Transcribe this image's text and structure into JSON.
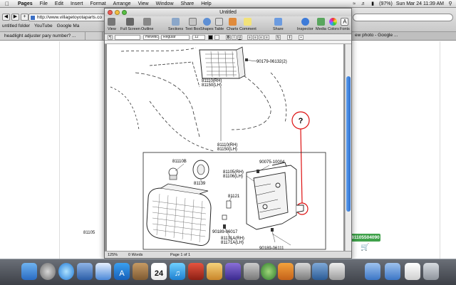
{
  "menubar": {
    "apple": "",
    "items": [
      "Pages",
      "File",
      "Edit",
      "Insert",
      "Format",
      "Arrange",
      "View",
      "Window",
      "Share",
      "Help"
    ],
    "battery": "(97%)",
    "clock": "Sun Mar 24  11:39 AM"
  },
  "browser": {
    "url": "http://www.villagetoyotaparts.co",
    "bookmarks": [
      "untitled folder",
      "YouTube",
      "Google Ma"
    ],
    "tabs": [
      "headlight adjuster pary number? ...",
      "",
      ""
    ],
    "tab_right": "ew photo - Google ...",
    "part_label_left": "81105",
    "part_badge": "81105504090"
  },
  "pages_window": {
    "title": "Untitled",
    "toolbar": [
      "View",
      "Full Screen",
      "Outline",
      "Sections",
      "Text Box",
      "Shapes",
      "Table",
      "Charts",
      "Comment",
      "Share",
      "Inspector",
      "Media",
      "Colors",
      "Fonts"
    ],
    "font_name": "Helvetica",
    "font_style": "Regular",
    "font_size": "12",
    "status": {
      "zoom": "125%",
      "words": "0 Words",
      "page": "Page 1 of 1"
    }
  },
  "diagram": {
    "question": "?",
    "labels": {
      "top_code": "90179-06132(2)",
      "top_rh": "81110(RH)",
      "top_lh": "81150(LH)",
      "mid_rh": "81110(RH)",
      "mid_lh": "81150(LH)",
      "bulb": "81110B",
      "bracket_top": "90075-10004",
      "unit_rh": "81105(RH)",
      "unit_lh": "81106(LH)",
      "socket": "81139",
      "clip": "81121",
      "screw_left": "90189-06017",
      "lamp_rh": "81131A(RH)",
      "lamp_lh": "81171A(LH)",
      "screw_bottom": "90189-06111"
    }
  },
  "dock": {
    "calendar_day": "24"
  }
}
